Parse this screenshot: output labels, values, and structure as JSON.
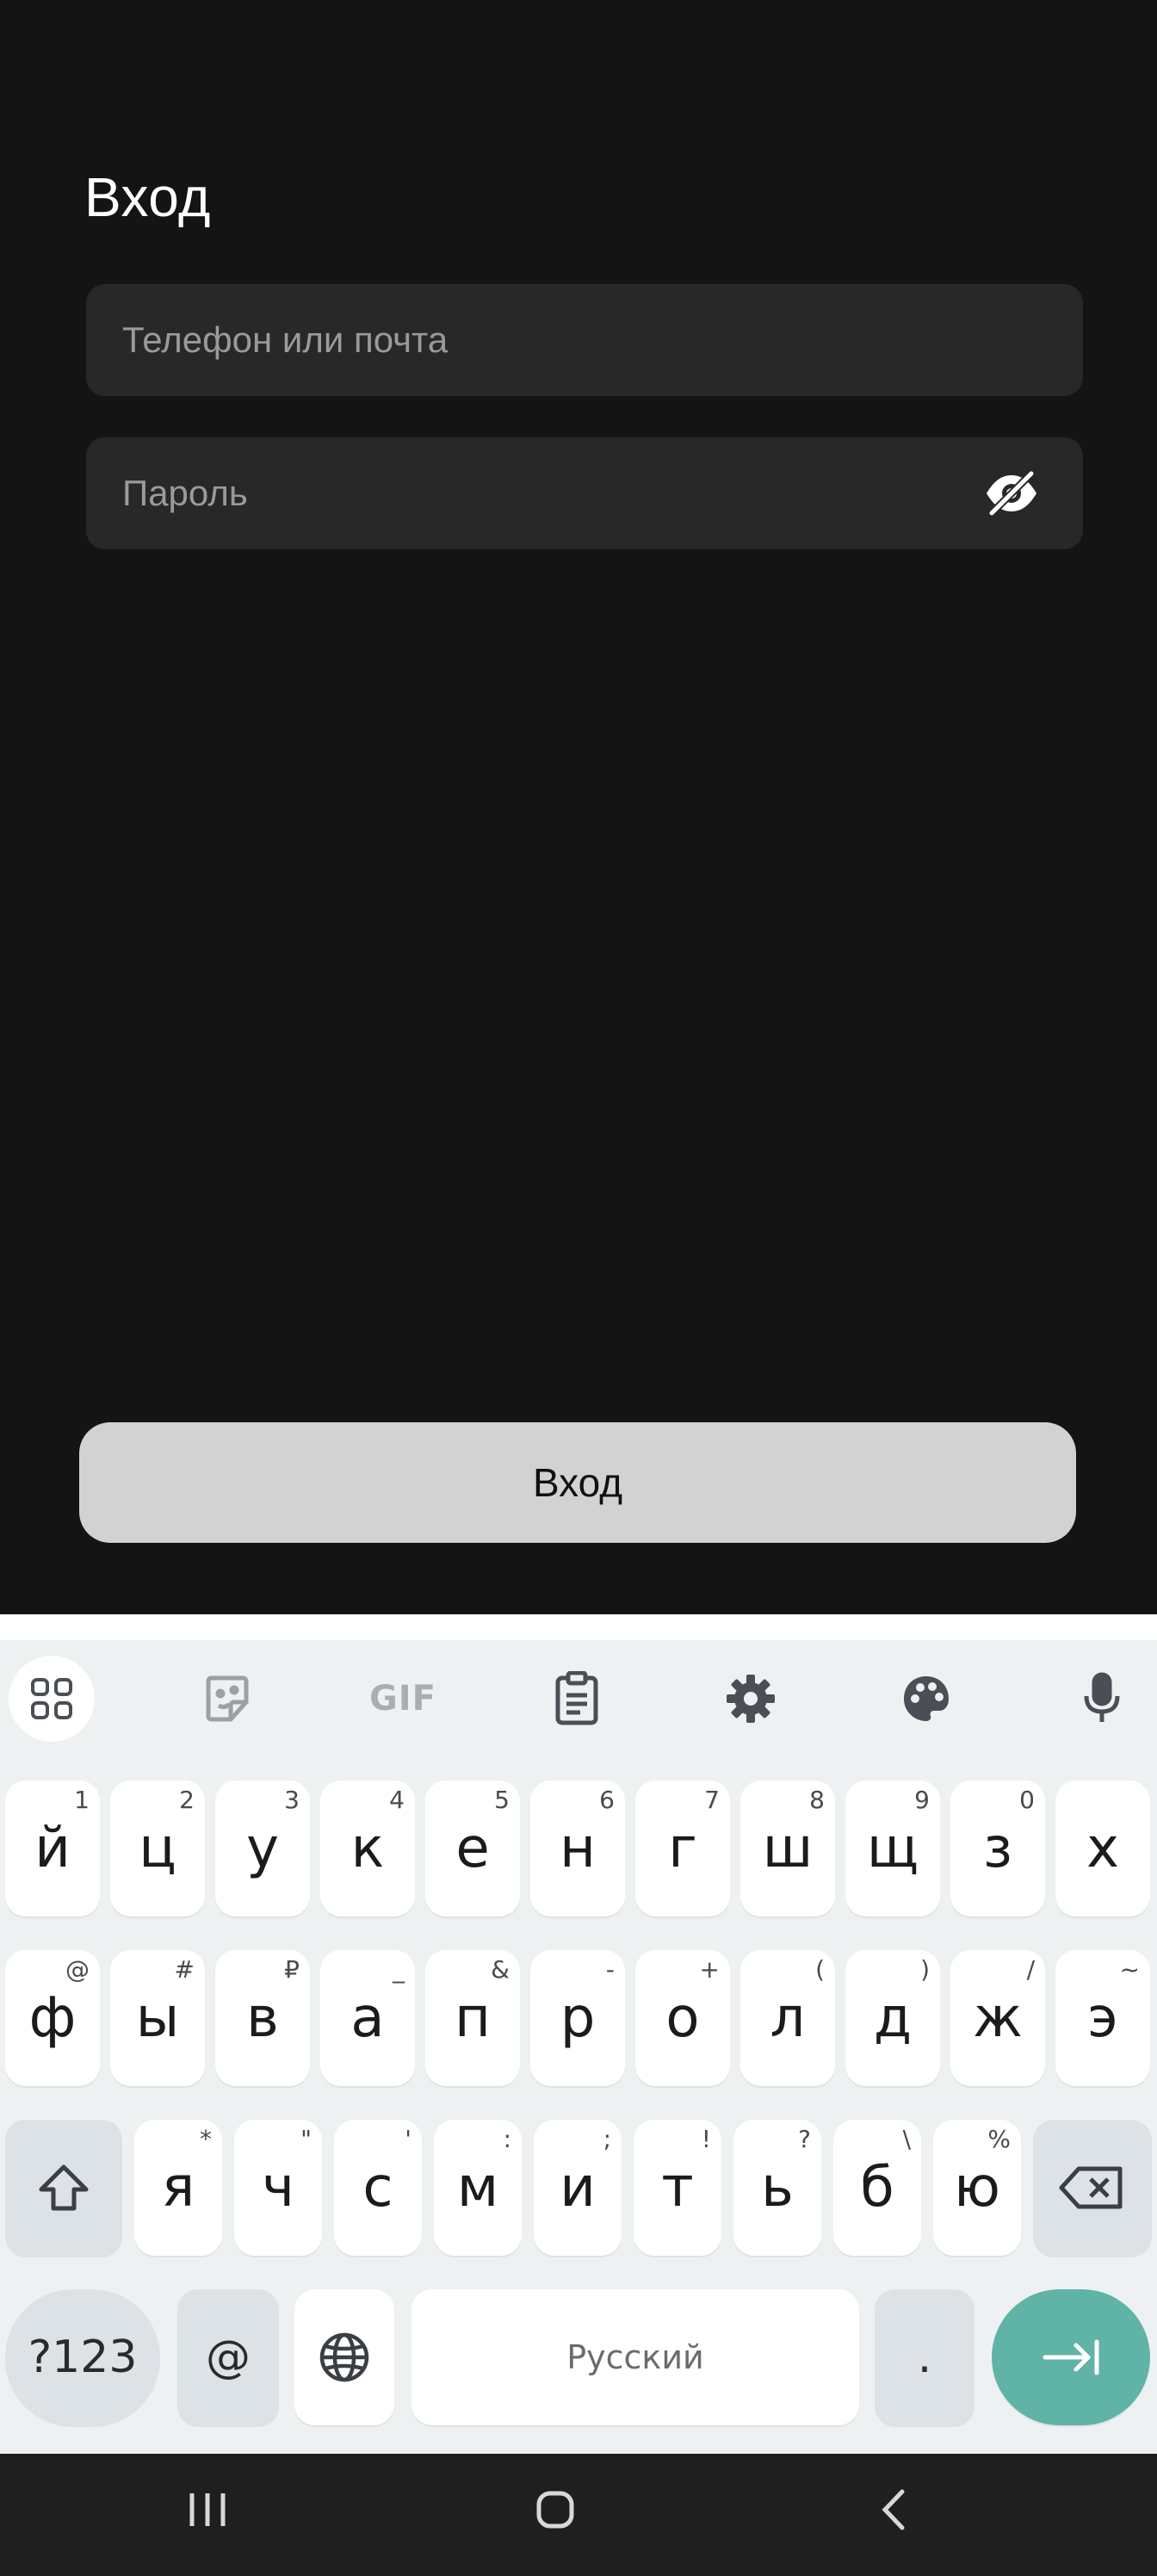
{
  "screen": {
    "title": "Вход",
    "login_placeholder": "Телефон или почта",
    "password_placeholder": "Пароль",
    "submit_label": "Вход"
  },
  "keyboard": {
    "toolbar": [
      "apps-icon",
      "sticker-icon",
      "gif-icon",
      "clipboard-icon",
      "settings-icon",
      "palette-icon",
      "mic-icon"
    ],
    "gif_label": "GIF",
    "row1": [
      {
        "k": "й",
        "h": "1"
      },
      {
        "k": "ц",
        "h": "2"
      },
      {
        "k": "у",
        "h": "3"
      },
      {
        "k": "к",
        "h": "4"
      },
      {
        "k": "е",
        "h": "5"
      },
      {
        "k": "н",
        "h": "6"
      },
      {
        "k": "г",
        "h": "7"
      },
      {
        "k": "ш",
        "h": "8"
      },
      {
        "k": "щ",
        "h": "9"
      },
      {
        "k": "з",
        "h": "0"
      },
      {
        "k": "х",
        "h": ""
      }
    ],
    "row2": [
      {
        "k": "ф",
        "h": "@"
      },
      {
        "k": "ы",
        "h": "#"
      },
      {
        "k": "в",
        "h": "₽"
      },
      {
        "k": "а",
        "h": "_"
      },
      {
        "k": "п",
        "h": "&"
      },
      {
        "k": "р",
        "h": "-"
      },
      {
        "k": "о",
        "h": "+"
      },
      {
        "k": "л",
        "h": "("
      },
      {
        "k": "д",
        "h": ")"
      },
      {
        "k": "ж",
        "h": "/"
      },
      {
        "k": "э",
        "h": "~"
      }
    ],
    "row3": [
      {
        "k": "я",
        "h": "*"
      },
      {
        "k": "ч",
        "h": "\""
      },
      {
        "k": "с",
        "h": "'"
      },
      {
        "k": "м",
        "h": ":"
      },
      {
        "k": "и",
        "h": ";"
      },
      {
        "k": "т",
        "h": "!"
      },
      {
        "k": "ь",
        "h": "?"
      },
      {
        "k": "б",
        "h": "\\"
      },
      {
        "k": "ю",
        "h": "%"
      }
    ],
    "sym_label": "?123",
    "at_label": "@",
    "space_label": "Русский",
    "period_label": "."
  },
  "colors": {
    "background": "#141414",
    "field": "#282828",
    "button": "#d2d2d2",
    "enter_key": "#5fb3a7"
  }
}
